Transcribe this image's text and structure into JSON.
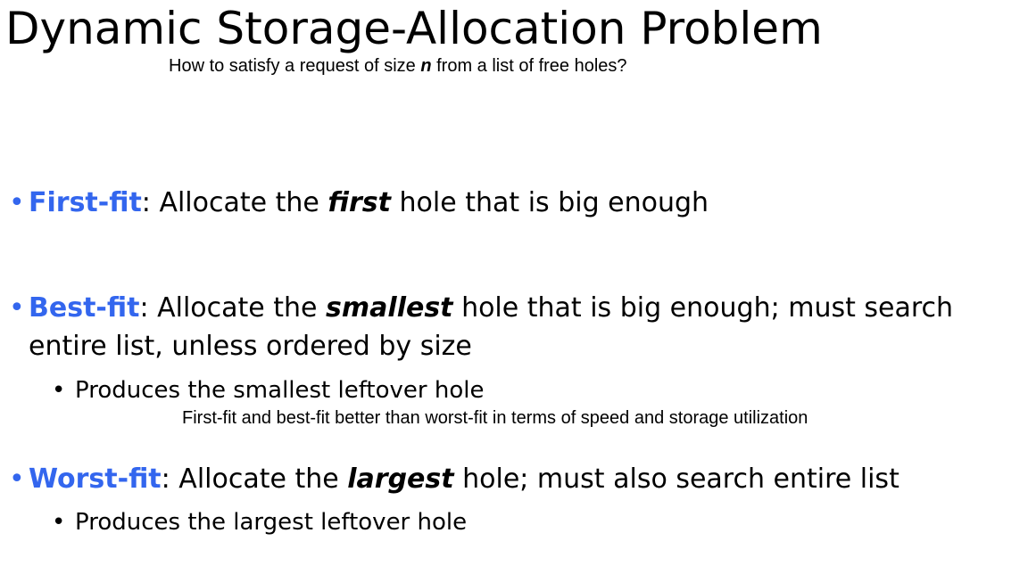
{
  "slide": {
    "title": "Dynamic Storage-Allocation Problem",
    "subtitle": {
      "before": "How to satisfy a request of size ",
      "var": "n",
      "after": " from a list of free holes?"
    },
    "bullets": [
      {
        "term": "First-fit",
        "sep": ":  Allocate the ",
        "emph": "first",
        "rest": " hole that is big enough"
      },
      {
        "term": "Best-fit",
        "sep": ":  Allocate the ",
        "emph": "smallest",
        "rest": " hole that is big enough; must search",
        "continuation": "entire list, unless ordered by size",
        "sub": "Produces the smallest leftover hole"
      },
      {
        "term": "Worst-fit",
        "sep": ":  Allocate the ",
        "emph": "largest",
        "rest": " hole; must also search entire list",
        "sub": "Produces the largest leftover hole"
      }
    ],
    "note": "First-fit and best-fit better than worst-fit in terms of speed and storage utilization",
    "bullet_glyph": "•",
    "colors": {
      "accent": "#3366ee",
      "text": "#000000",
      "background": "#ffffff"
    }
  }
}
